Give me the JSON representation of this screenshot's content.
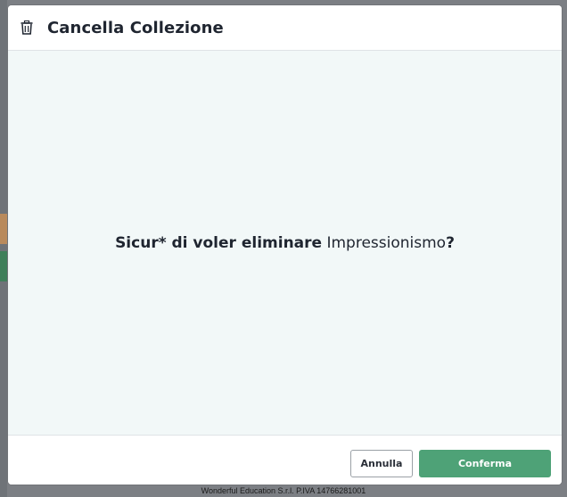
{
  "modal": {
    "title": "Cancella Collezione",
    "header_icon": "trash-icon",
    "question": {
      "prefix": "Sicur* di voler eliminare",
      "collection_name": "Impressionismo",
      "suffix": "?"
    },
    "buttons": {
      "cancel_label": "Annulla",
      "confirm_label": "Conferma"
    }
  },
  "footer": {
    "credit": "Wonderful Education S.r.l. P.IVA 14766281001"
  },
  "colors": {
    "confirm_button": "#4ea277",
    "body_background": "#f2f8f8",
    "title_text": "#1f2530"
  }
}
